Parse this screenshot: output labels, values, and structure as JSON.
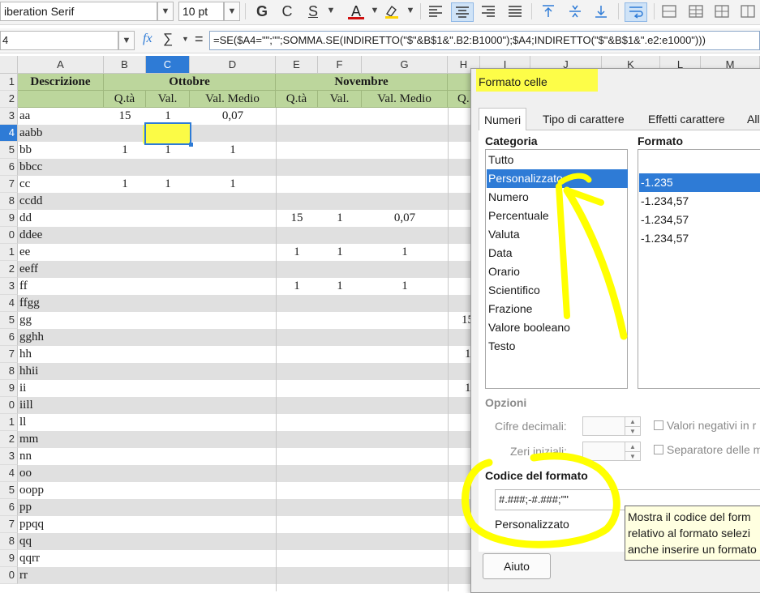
{
  "toolbar": {
    "font_name": "iberation Serif",
    "font_size": "10 pt",
    "bold": "G",
    "italic": "C",
    "underline": "S",
    "font_color_letter": "A"
  },
  "formula_bar": {
    "name_box": "4",
    "fx": "fx",
    "sigma": "∑",
    "equals": "=",
    "formula": "=SE($A4=\"\";\"\";SOMMA.SE(INDIRETTO(\"$\"&B$1&\".B2:B1000\");$A4;INDIRETTO(\"$\"&B$1&\".e2:e1000\")))"
  },
  "grid": {
    "columns": [
      "A",
      "B",
      "C",
      "D",
      "E",
      "F",
      "G",
      "H",
      "I",
      "J",
      "K",
      "L",
      "M"
    ],
    "row_numbers": [
      "1",
      "2",
      "3",
      "4",
      "5",
      "6",
      "7",
      "8",
      "9",
      "0",
      "1",
      "2",
      "3",
      "4",
      "5",
      "6",
      "7",
      "8",
      "9",
      "0",
      "1",
      "2",
      "3",
      "4",
      "5",
      "6",
      "7",
      "8",
      "9",
      "0"
    ],
    "header_row1": {
      "descrizione": "Descrizione",
      "ottobre": "Ottobre",
      "novembre": "Novembre"
    },
    "header_row2": {
      "qta": "Q.tà",
      "val": "Val.",
      "val_medio": "Val. Medio",
      "h_partial": "Q."
    },
    "col_a": [
      "aa",
      "aabb",
      "bb",
      "bbcc",
      "cc",
      "ccdd",
      "dd",
      "ddee",
      "ee",
      "eeff",
      "ff",
      "ffgg",
      "gg",
      "gghh",
      "hh",
      "hhii",
      "ii",
      "iill",
      "ll",
      "mm",
      "nn",
      "oo",
      "oopp",
      "pp",
      "ppqq",
      "qq",
      "qqrr",
      "rr"
    ],
    "data": {
      "r3": {
        "b": "15",
        "c": "1",
        "d": "0,07"
      },
      "r5": {
        "b": "1",
        "c": "1",
        "d": "1"
      },
      "r7": {
        "b": "1",
        "c": "1",
        "d": "1"
      },
      "r9": {
        "e": "15",
        "f": "1",
        "g": "0,07"
      },
      "r11": {
        "e": "1",
        "f": "1",
        "g": "1"
      },
      "r13": {
        "e": "1",
        "f": "1",
        "g": "1"
      },
      "r15": {
        "h": "15"
      },
      "r17": {
        "h": "1"
      },
      "r19": {
        "h": "1"
      }
    }
  },
  "dialog": {
    "title": "Formato celle",
    "tabs": [
      "Numeri",
      "Tipo di carattere",
      "Effetti carattere",
      "All"
    ],
    "categoria_label": "Categoria",
    "formato_label": "Formato",
    "categories": [
      "Tutto",
      "Personalizzato",
      "Numero",
      "Percentuale",
      "Valuta",
      "Data",
      "Orario",
      "Scientifico",
      "Frazione",
      "Valore booleano",
      "Testo"
    ],
    "selected_category": "Personalizzato",
    "formats": [
      "-1.235",
      "-1.234,57",
      "-1.234,57",
      "-1.234,57"
    ],
    "opzioni_label": "Opzioni",
    "cifre_decimali": "Cifre decimali:",
    "zeri_iniziali": "Zeri iniziali:",
    "valori_negativi": "Valori negativi in r",
    "separatore": "Separatore delle m",
    "codice_label": "Codice del formato",
    "codice_value": "#.###;-#.###;\"\"",
    "personalizzato_desc": "Personalizzato",
    "tooltip_lines": [
      "Mostra il codice del form",
      "relativo al formato selezi",
      "anche inserire un formato"
    ],
    "help_button": "Aiuto"
  },
  "colors": {
    "accent": "#2e7bd6",
    "header_green": "#bcd69c",
    "highlight": "#ffff00"
  }
}
